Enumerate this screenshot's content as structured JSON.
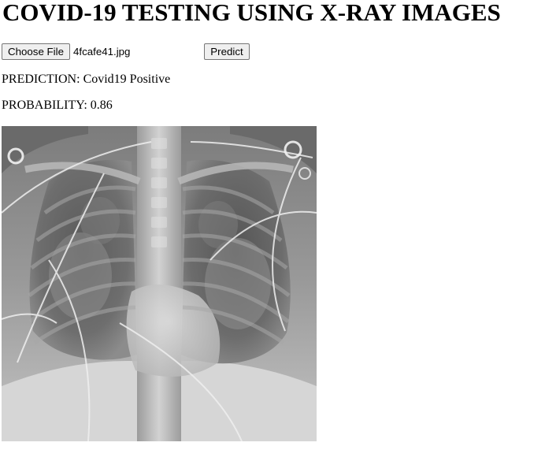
{
  "page": {
    "title": "COVID-19 TESTING USING X-RAY IMAGES"
  },
  "upload": {
    "choose_label": "Choose File",
    "file_name": "4fcafe41.jpg",
    "predict_label": "Predict"
  },
  "result": {
    "prediction_label": "PREDICTION:",
    "prediction_value": "Covid19 Positive",
    "probability_label": "PROBABILITY:",
    "probability_value": "0.86"
  },
  "image": {
    "icon": "chest-xray-image"
  }
}
